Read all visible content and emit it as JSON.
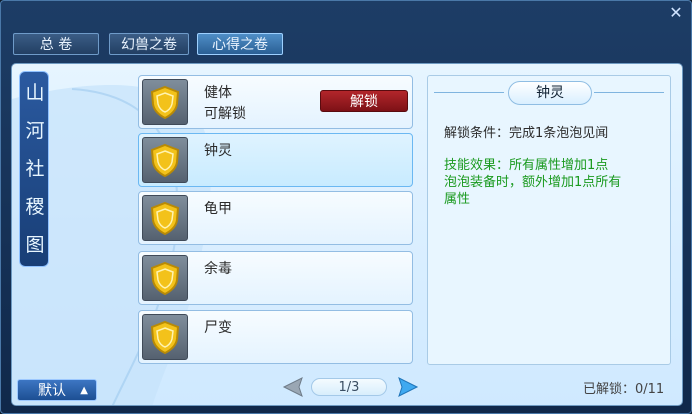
{
  "window": {
    "close": "✕"
  },
  "tabs": [
    {
      "label": "总 卷"
    },
    {
      "label": "幻兽之卷"
    },
    {
      "label": "心得之卷",
      "active": true
    }
  ],
  "banner": {
    "chars": [
      "山",
      "河",
      "社",
      "稷",
      "图"
    ]
  },
  "items": [
    {
      "name": "健体",
      "status": "可解锁",
      "button": "解锁"
    },
    {
      "name": "钟灵",
      "status": "",
      "selected": true
    },
    {
      "name": "龟甲",
      "status": ""
    },
    {
      "name": "余毒",
      "status": ""
    },
    {
      "name": "尸变",
      "status": ""
    }
  ],
  "detail": {
    "title": "钟灵",
    "condition": "解锁条件：完成1条泡泡见闻",
    "effect_lines": [
      "技能效果：所有属性增加1点",
      "泡泡装备时，额外增加1点所有",
      "属性"
    ]
  },
  "bottom": {
    "default_label": "默认",
    "page": "1/3",
    "unlocked": "已解锁：0/11"
  },
  "colors": {
    "accent": "#4f8ec7",
    "unlock_button": "#b3262b",
    "effect_text": "#1a9a1f",
    "shield": "#f3c21a"
  }
}
